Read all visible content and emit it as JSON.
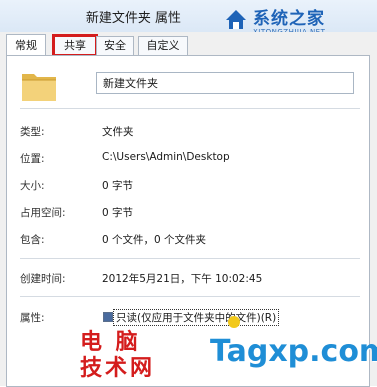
{
  "window": {
    "title": "新建文件夹 属性"
  },
  "watermark_top": {
    "text": "系统之家",
    "sub": "XITONGZHIJIA.NET"
  },
  "tabs": [
    {
      "label": "常规",
      "active": true
    },
    {
      "label": "共享",
      "active": false,
      "highlighted": true
    },
    {
      "label": "安全",
      "active": false
    },
    {
      "label": "自定义",
      "active": false
    }
  ],
  "folder": {
    "name": "新建文件夹"
  },
  "properties": [
    {
      "label": "类型:",
      "value": "文件夹"
    },
    {
      "label": "位置:",
      "value": "C:\\Users\\Admin\\Desktop"
    },
    {
      "label": "大小:",
      "value": "0 字节"
    },
    {
      "label": "占用空间:",
      "value": "0 字节"
    },
    {
      "label": "包含:",
      "value": "0 个文件，0 个文件夹"
    }
  ],
  "created": {
    "label": "创建时间:",
    "value": "2012年5月21日，下午 10:02:45"
  },
  "attributes": {
    "label": "属性:",
    "readonly": "只读(仅应用于文件夹中的文件)(R)"
  },
  "watermark_bottom": {
    "line1": "电 脑",
    "line2": "技术网",
    "site": "Tagxp.com"
  },
  "colors": {
    "highlight": "#d41c1c",
    "accent": "#1e63b7"
  }
}
